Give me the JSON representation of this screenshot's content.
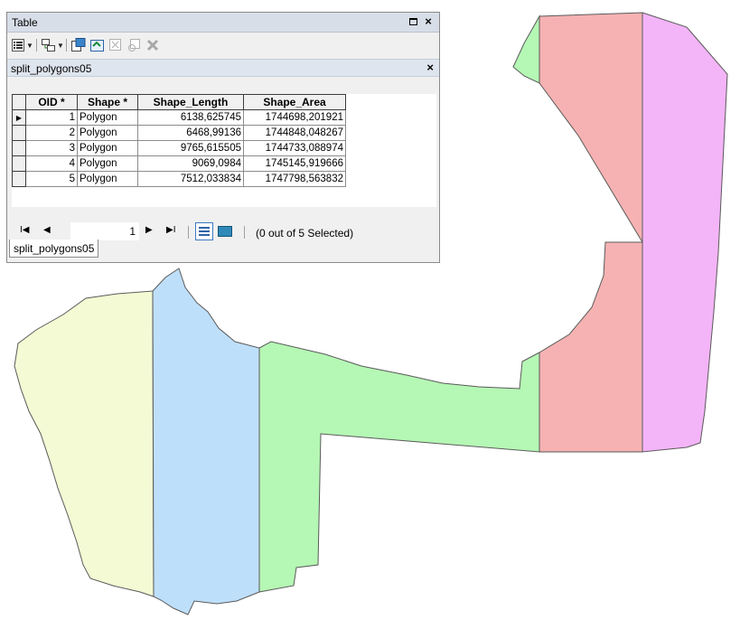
{
  "window": {
    "title": "Table",
    "restore_label": "",
    "close_label": "×"
  },
  "toolbar": {
    "icons": [
      "table-options-icon",
      "related-tables-icon",
      "select-by-attributes-icon",
      "switch-selection-icon",
      "clear-selection-icon",
      "zoom-to-selected-icon",
      "delete-selected-icon"
    ]
  },
  "layer_tab": {
    "name": "split_polygons05",
    "close_label": "×"
  },
  "table": {
    "columns": [
      "OID *",
      "Shape *",
      "Shape_Length",
      "Shape_Area"
    ],
    "rows": [
      {
        "oid": "1",
        "shape": "Polygon",
        "length": "6138,625745",
        "area": "1744698,201921"
      },
      {
        "oid": "2",
        "shape": "Polygon",
        "length": "6468,99136",
        "area": "1744848,048267"
      },
      {
        "oid": "3",
        "shape": "Polygon",
        "length": "9765,615505",
        "area": "1744733,088974"
      },
      {
        "oid": "4",
        "shape": "Polygon",
        "length": "9069,0984",
        "area": "1745145,919666"
      },
      {
        "oid": "5",
        "shape": "Polygon",
        "length": "7512,033834",
        "area": "1747798,563832"
      }
    ],
    "current_row_marker": "▶"
  },
  "navigation": {
    "first_label": "I◀",
    "prev_label": "◀",
    "current_record": "1",
    "next_label": "▶",
    "last_label": "▶I",
    "selected_status": "(0 out of 5 Selected)"
  },
  "bottom_tab": {
    "label": "split_polygons05"
  },
  "map": {
    "polygon_colors": {
      "yellow": "#f4fad4",
      "blue": "#bedffa",
      "green": "#b5f7b5",
      "red": "#f6b2b2",
      "pink": "#f4b4f8"
    },
    "outline_color": "#5a5a5a"
  }
}
